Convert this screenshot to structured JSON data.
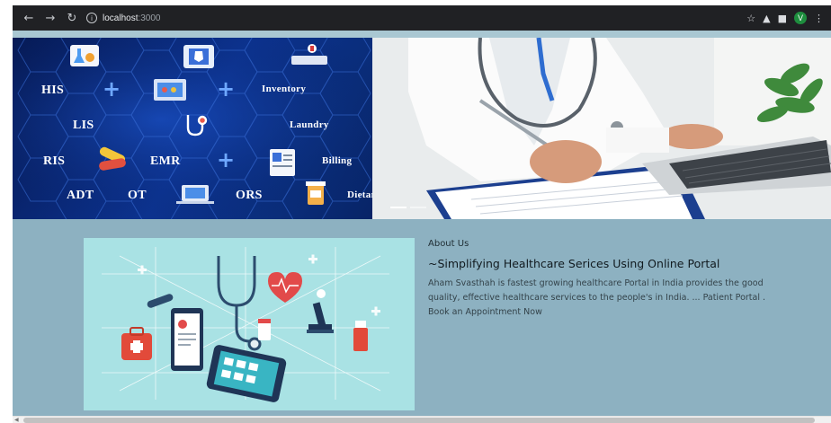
{
  "browser": {
    "url_host": "localhost",
    "url_port": ":3000",
    "avatar_letter": "V",
    "back_icon": "arrow-left-icon",
    "forward_icon": "arrow-right-icon",
    "reload_icon": "reload-icon",
    "info_icon": "info-icon",
    "star_icon": "star-icon",
    "extension_icons": [
      "extension-icon",
      "puzzle-icon",
      "menu-kebab-icon"
    ]
  },
  "hero": {
    "modules": [
      "HIS",
      "Inventory",
      "LIS",
      "Laundry",
      "RIS",
      "EMR",
      "Billing",
      "ADT",
      "OT",
      "ORS",
      "Dietary"
    ],
    "accent_color": "#e8d23a",
    "theme_color": "#0c3391"
  },
  "about": {
    "eyebrow": "About Us",
    "title": "~Simplifying Healthcare Serices Using Online Portal",
    "body": "Aham Svasthah is fastest growing healthcare Portal in India provides the good quality, effective healthcare services to the people's in India. ... Patient Portal . Book an Appointment Now"
  },
  "colors": {
    "page_background": "#8db1c1",
    "image_background": "#a9e2e4"
  }
}
